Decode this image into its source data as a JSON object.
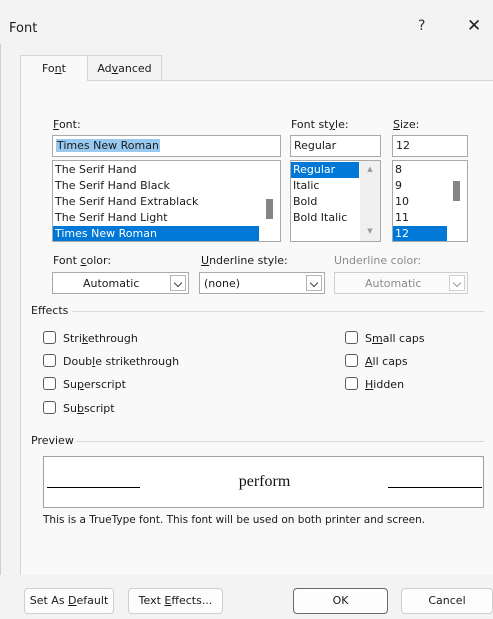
{
  "window": {
    "title": "Font",
    "help_glyph": "?",
    "close_glyph": "✕"
  },
  "tabs": [
    {
      "pre": "Fo",
      "accel": "n",
      "post": "t"
    },
    {
      "pre": "Ad",
      "accel": "v",
      "post": "anced"
    }
  ],
  "font": {
    "label_accel": "F",
    "label_rest": "ont:",
    "value": "Times New Roman",
    "items": [
      "The Serif Hand",
      "The Serif Hand Black",
      "The Serif Hand Extrablack",
      "The Serif Hand Light",
      "Times New Roman"
    ],
    "selected_index": 4
  },
  "style": {
    "label_pre": "Font st",
    "label_accel": "y",
    "label_post": "le:",
    "value": "Regular",
    "items": [
      "Regular",
      "Italic",
      "Bold",
      "Bold Italic"
    ],
    "selected_index": 0
  },
  "size": {
    "label_accel": "S",
    "label_rest": "ize:",
    "value": "12",
    "items": [
      "8",
      "9",
      "10",
      "11",
      "12"
    ],
    "selected_index": 4
  },
  "font_color": {
    "label_pre": "Font ",
    "label_accel": "c",
    "label_post": "olor:",
    "value": "Automatic"
  },
  "underline_style": {
    "label_accel": "U",
    "label_rest": "nderline style:",
    "value": "(none)"
  },
  "underline_color": {
    "label": "Underline color:",
    "value": "Automatic"
  },
  "effects": {
    "title": "Effects",
    "left": [
      {
        "pre": "Stri",
        "accel": "k",
        "post": "ethrough",
        "checked": false
      },
      {
        "pre": "Doub",
        "accel": "l",
        "post": "e strikethrough",
        "checked": false
      },
      {
        "pre": "Su",
        "accel": "p",
        "post": "erscript",
        "checked": false
      },
      {
        "pre": "Su",
        "accel": "b",
        "post": "script",
        "checked": false
      }
    ],
    "right": [
      {
        "pre": "S",
        "accel": "m",
        "post": "all caps",
        "checked": false
      },
      {
        "pre": "",
        "accel": "A",
        "post": "ll caps",
        "checked": false
      },
      {
        "pre": "",
        "accel": "H",
        "post": "idden",
        "checked": false
      }
    ]
  },
  "preview": {
    "title": "Preview",
    "sample": "perform",
    "note": "This is a TrueType font. This font will be used on both printer and screen."
  },
  "buttons": {
    "set_default": {
      "pre": "Set As ",
      "accel": "D",
      "post": "efault"
    },
    "text_effects": {
      "pre": "Text ",
      "accel": "E",
      "post": "ffects..."
    },
    "ok": "OK",
    "cancel": "Cancel"
  }
}
